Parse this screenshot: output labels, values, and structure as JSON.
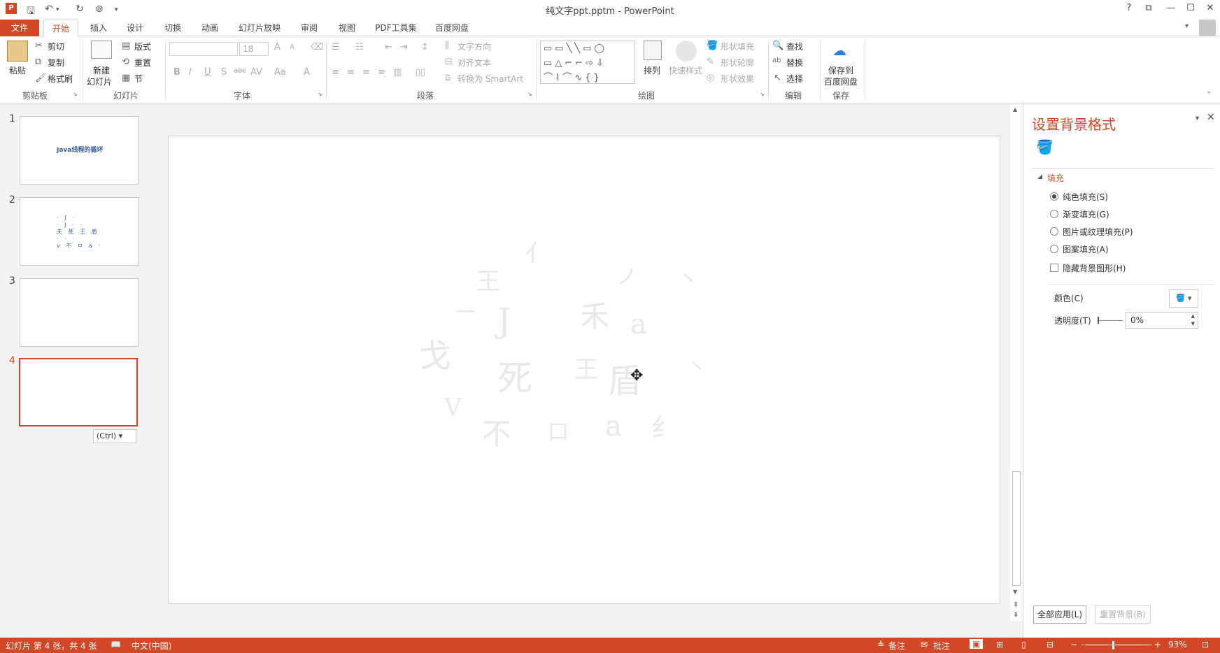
{
  "window": {
    "title": "纯文字ppt.pptm - PowerPoint",
    "help": "?",
    "restore_ribbon": "⧉",
    "minimize": "—",
    "maximize": "☐",
    "close": "✕"
  },
  "tabs": [
    "文件",
    "开始",
    "插入",
    "设计",
    "切换",
    "动画",
    "幻灯片放映",
    "审阅",
    "视图",
    "PDF工具集",
    "百度网盘"
  ],
  "ribbon": {
    "clipboard": {
      "paste": "粘贴",
      "cut": "剪切",
      "copy": "复制",
      "format_painter": "格式刷",
      "group": "剪贴板"
    },
    "slides": {
      "new_slide_line1": "新建",
      "new_slide_line2": "幻灯片",
      "layout": "版式",
      "reset": "重置",
      "section": "节",
      "group": "幻灯片"
    },
    "font": {
      "font_name": "",
      "font_size": "18",
      "group": "字体",
      "bold": "B",
      "italic": "I",
      "underline": "U",
      "shadow": "S",
      "strike": "abc",
      "spacing": "AV",
      "case": "Aa",
      "color": "A",
      "grow": "A",
      "shrink": "A"
    },
    "paragraph": {
      "text_direction": "文字方向",
      "align_text": "对齐文本",
      "convert_smartart": "转换为 SmartArt",
      "group": "段落"
    },
    "drawing": {
      "arrange": "排列",
      "quick_styles": "快速样式",
      "shape_fill": "形状填充",
      "shape_outline": "形状轮廓",
      "shape_effects": "形状效果",
      "group": "绘图"
    },
    "editing": {
      "find": "查找",
      "replace": "替换",
      "select": "选择",
      "group": "编辑"
    },
    "save": {
      "line1": "保存到",
      "line2": "百度网盘",
      "group": "保存"
    }
  },
  "slides": [
    {
      "num": "1",
      "text": "Java线程的循环"
    },
    {
      "num": "2",
      "text": ""
    },
    {
      "num": "3",
      "text": ""
    },
    {
      "num": "4",
      "text": ""
    }
  ],
  "paste_options": "(Ctrl)",
  "slide_chars": [
    "亻",
    "王",
    "J",
    "禾",
    "a",
    "戈",
    "死",
    "王",
    "盾",
    "V",
    "不",
    "口",
    "a",
    "纟",
    "丶",
    "丶",
    "一",
    "ノ"
  ],
  "format_pane": {
    "title": "设置背景格式",
    "section": "填充",
    "options": [
      "纯色填充(S)",
      "渐变填充(G)",
      "图片或纹理填充(P)",
      "图案填充(A)"
    ],
    "selected_option": 0,
    "hide_bg": "隐藏背景图形(H)",
    "color_label": "颜色(C)",
    "transparency_label": "透明度(T)",
    "transparency_value": "0%",
    "apply_all": "全部应用(L)",
    "reset_bg": "重置背景(B)"
  },
  "status": {
    "slide_info": "幻灯片 第 4 张，共 4 张",
    "language": "中文(中国)",
    "notes": "备注",
    "comments": "批注",
    "zoom": "93%"
  },
  "colors": {
    "accent": "#d24726",
    "thumb_text": "#2e5f9e"
  }
}
